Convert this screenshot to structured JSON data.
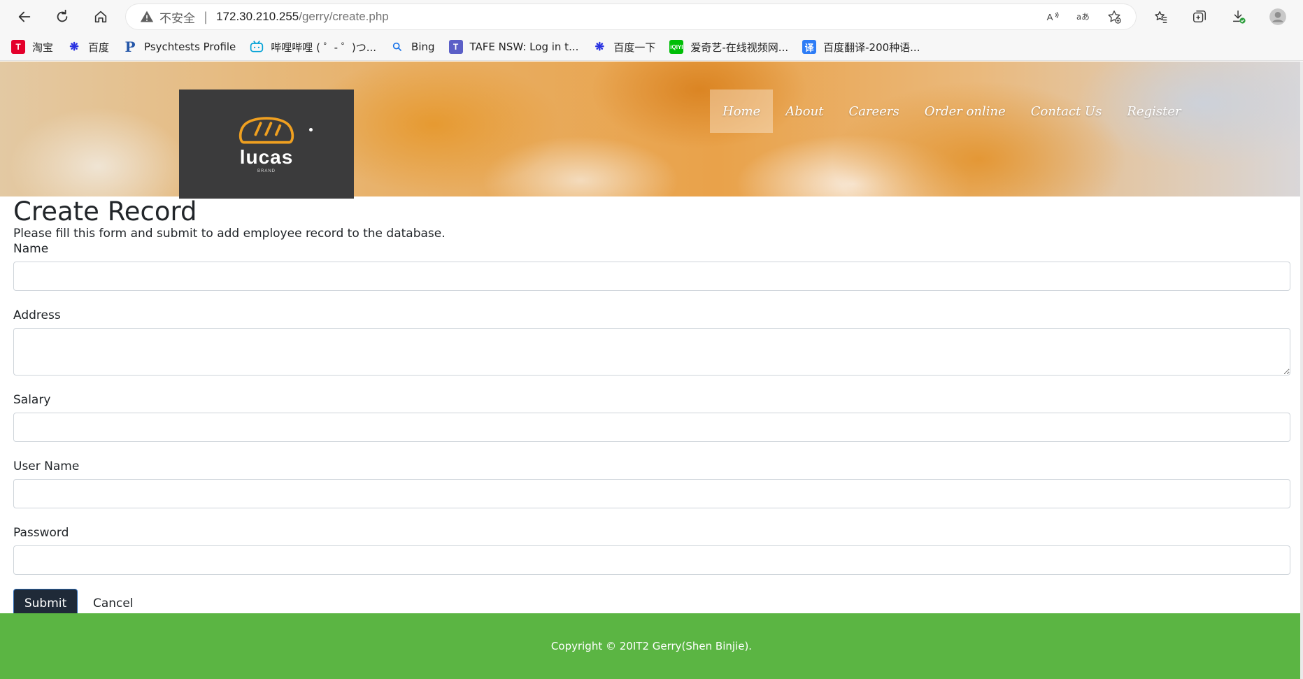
{
  "browser": {
    "insecure_label": "不安全",
    "url_host": "172.30.210.255",
    "url_path": "/gerry/create.php",
    "bookmarks": [
      {
        "label": "淘宝",
        "color": "#e4002b",
        "glyph": "T"
      },
      {
        "label": "百度",
        "color": "#2932e1",
        "glyph": "🐾"
      },
      {
        "label": "Psychtests Profile",
        "color": "#2456a8",
        "glyph": "P"
      },
      {
        "label": "哔哩哔哩 ( ゜- ゜)つ...",
        "color": "#00a1d6",
        "glyph": "▣"
      },
      {
        "label": "Bing",
        "color": "#1a73e8",
        "glyph": "Q"
      },
      {
        "label": "TAFE NSW: Log in t...",
        "color": "#5b5fc7",
        "glyph": "T"
      },
      {
        "label": "百度一下",
        "color": "#2932e1",
        "glyph": "🐾"
      },
      {
        "label": "爱奇艺-在线视频网...",
        "color": "#00be06",
        "glyph": "iQ"
      },
      {
        "label": "百度翻译-200种语...",
        "color": "#2d7cf6",
        "glyph": "译"
      }
    ]
  },
  "site": {
    "logo_text": "lucas",
    "logo_sub": "BRAND",
    "menu": [
      {
        "label": "Home",
        "active": true
      },
      {
        "label": "About",
        "active": false
      },
      {
        "label": "Careers",
        "active": false
      },
      {
        "label": "Order online",
        "active": false
      },
      {
        "label": "Contact Us",
        "active": false
      },
      {
        "label": "Register",
        "active": false
      }
    ]
  },
  "form": {
    "title": "Create Record",
    "description": "Please fill this form and submit to add employee record to the database.",
    "fields": {
      "name": {
        "label": "Name",
        "value": ""
      },
      "address": {
        "label": "Address",
        "value": ""
      },
      "salary": {
        "label": "Salary",
        "value": ""
      },
      "username": {
        "label": "User Name",
        "value": ""
      },
      "password": {
        "label": "Password",
        "value": ""
      }
    },
    "submit_label": "Submit",
    "cancel_label": "Cancel"
  },
  "footer": {
    "copyright": "Copyright © 20IT2 Gerry(Shen Binjie)."
  },
  "colors": {
    "footer_bg": "#5bb543",
    "submit_bg": "#1f2a38",
    "logo_bg": "#3b3b3c",
    "bread_icon": "#f0a020"
  }
}
